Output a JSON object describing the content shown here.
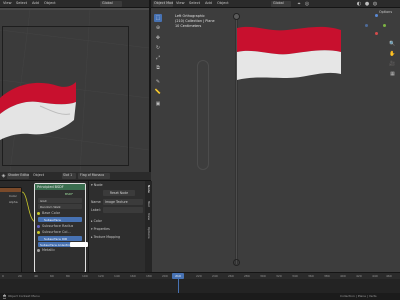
{
  "viewport_left": {
    "menu": [
      "View",
      "Select",
      "Add",
      "Object"
    ],
    "object_mode": "Object Mode",
    "global": "Global"
  },
  "viewport_right": {
    "menu": [
      "Object Mode",
      "View",
      "Select",
      "Add",
      "Object"
    ],
    "global": "Global",
    "overlay_lines": [
      "Left Orthographic",
      "(210) Collection | Plane",
      "10 Centimeters"
    ],
    "options": "Options"
  },
  "shader_editor": {
    "editor_type": "Shader Editor",
    "object": "Object",
    "menu": [
      "View",
      "Select",
      "Add",
      "Node"
    ],
    "slot": "Slot 1",
    "material": "Flag of Monaco",
    "node_title": "Principled BSDF",
    "rows": [
      "BSDF",
      "GGX",
      "Random Walk",
      "Base Color",
      "Subsurface",
      "Subsurface Radius",
      "Subsurface Col...",
      "Subsurface IOR",
      "Subsurface Anisotropy",
      "Metallic"
    ],
    "base_color_hex": "#ffffff",
    "left_node_rows": [
      "Color",
      "Alpha"
    ]
  },
  "n_panel": {
    "tabs": [
      "Node",
      "Tool",
      "View",
      "Options"
    ],
    "name_label": "Name:",
    "name_value": "Image Texture",
    "label_label": "Label:",
    "label_value": "",
    "sections": [
      "Node",
      "Color",
      "Properties",
      "Texture Mapping"
    ],
    "reset_label": "Reset Node"
  },
  "timeline": {
    "ticks": [
      "0",
      "20",
      "40",
      "60",
      "80",
      "100",
      "120",
      "140",
      "160",
      "180",
      "200",
      "220",
      "240",
      "260",
      "280",
      "300",
      "320",
      "340",
      "360",
      "380",
      "400",
      "420",
      "440",
      "460",
      "480",
      "500"
    ],
    "current_frame": "210",
    "start": "1",
    "end": "250"
  },
  "status_bar": {
    "left": "Object Context Menu",
    "right": "Collection | Plane | Verts"
  },
  "colors": {
    "flag_red": "#c8102e",
    "flag_white": "#e8e8e8",
    "accent_blue": "#4772b3",
    "node_header": "#3a6e4f"
  }
}
